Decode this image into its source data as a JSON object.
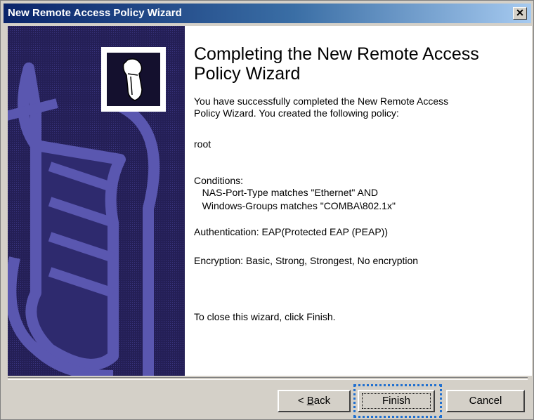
{
  "window": {
    "title": "New Remote Access Policy Wizard",
    "close_glyph": "✕"
  },
  "content": {
    "heading": "Completing the New Remote Access Policy Wizard",
    "intro": "You have successfully completed the New Remote Access\nPolicy Wizard. You created the following policy:",
    "policy_name": "root",
    "conditions_label": "Conditions:",
    "conditions_line1": "   NAS-Port-Type matches \"Ethernet\" AND",
    "conditions_line2": "   Windows-Groups matches \"COMBA\\802.1x\"",
    "authentication": "Authentication: EAP(Protected EAP (PEAP))",
    "encryption": "Encryption: Basic, Strong, Strongest, No encryption",
    "close_hint": "To close this wizard, click Finish."
  },
  "buttons": {
    "back_prefix": "< ",
    "back_mnemonic": "B",
    "back_rest": "ack",
    "finish": "Finish",
    "cancel": "Cancel"
  },
  "colors": {
    "titlebar_start": "#0a246a",
    "left_panel": "#241f56",
    "focus_ring": "#1f6fd0"
  },
  "icons": {
    "wizard_logo": "person-figure-icon",
    "background_art": "scroll-document-art"
  }
}
